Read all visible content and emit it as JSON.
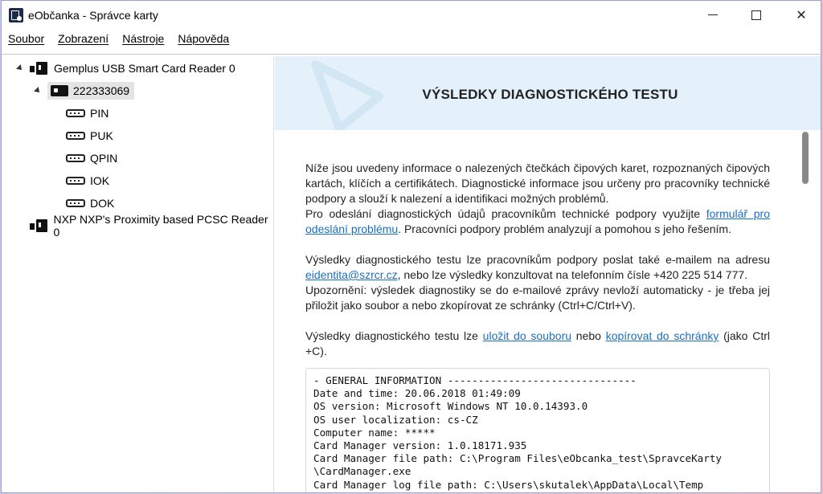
{
  "window": {
    "title": "eObčanka - Správce karty"
  },
  "menu": {
    "items": [
      "Soubor",
      "Zobrazení",
      "Nástroje",
      "Nápověda"
    ]
  },
  "tree": {
    "reader1": "Gemplus USB Smart Card Reader 0",
    "card": "222333069",
    "children": [
      "PIN",
      "PUK",
      "QPIN",
      "IOK",
      "DOK"
    ],
    "reader2": "NXP NXP's Proximity based PCSC Reader 0"
  },
  "banner": {
    "title": "VÝSLEDKY DIAGNOSTICKÉHO TESTU"
  },
  "content": {
    "p1_text": "Níže jsou uvedeny informace o nalezených čtečkách čipových karet, rozpoznaných čipových kartách, klíčích a certifikátech. Diagnostické informace jsou určeny pro pracovníky technické podpory a slouží k nalezení a identifikaci možných problémů.",
    "p1b_before": "Pro odeslání diagnostických údajů pracovníkům technické podpory využijte ",
    "p1b_link": "formulář pro odeslání problému",
    "p1b_after": ". Pracovníci podpory problém analyzují a pomohou s jeho řešením.",
    "p2_before": "Výsledky diagnostického testu lze pracovníkům podpory poslat také e-mailem na adresu ",
    "p2_link": "eidentita@szrcr.cz",
    "p2_after": ", nebo lze výsledky konzultovat na telefonním čísle +420 225 514 777.",
    "p2b": "Upozornění: výsledek diagnostiky se do e-mailové zprávy nevloží automaticky - je třeba jej přiložit jako soubor a nebo zkopírovat ze schránky (Ctrl+C/Ctrl+V).",
    "p3_before": "Výsledky diagnostického testu lze ",
    "p3_link1": "uložit do souboru",
    "p3_mid": " nebo ",
    "p3_link2": "kopírovat do schránky",
    "p3_after": " (jako Ctrl +C)."
  },
  "log": {
    "lines": [
      "- GENERAL INFORMATION -------------------------------",
      "Date and time: 20.06.2018 01:49:09",
      "OS version: Microsoft Windows NT 10.0.14393.0",
      "OS user localization: cs-CZ",
      "Computer name: *****",
      "Card Manager version: 1.0.18171.935",
      "Card Manager file path: C:\\Program Files\\eObcanka_test\\SpravceKarty",
      "\\CardManager.exe",
      "Card Manager log file path: C:\\Users\\skutalek\\AppData\\Local\\Temp"
    ]
  },
  "colors": {
    "link": "#1a6fc0",
    "banner_bg": "#e4f1fa"
  }
}
